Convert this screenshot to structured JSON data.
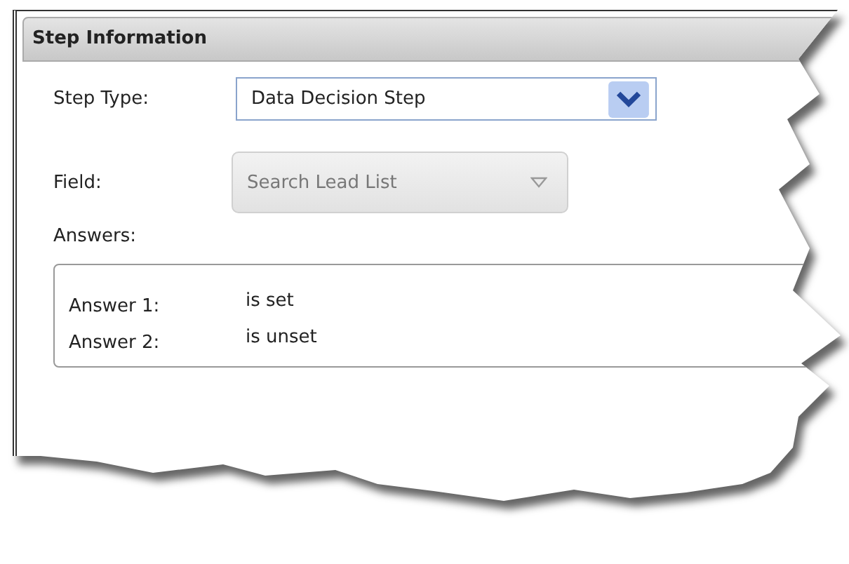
{
  "panel": {
    "title": "Step Information"
  },
  "step_type": {
    "label": "Step Type:",
    "value": "Data Decision Step",
    "disabled": false
  },
  "field": {
    "label": "Field:",
    "value": "Search Lead List",
    "disabled": true
  },
  "answers": {
    "label": "Answers:",
    "items": [
      {
        "label": "Answer 1:",
        "value": "is set"
      },
      {
        "label": "Answer 2:",
        "value": "is unset"
      }
    ]
  }
}
